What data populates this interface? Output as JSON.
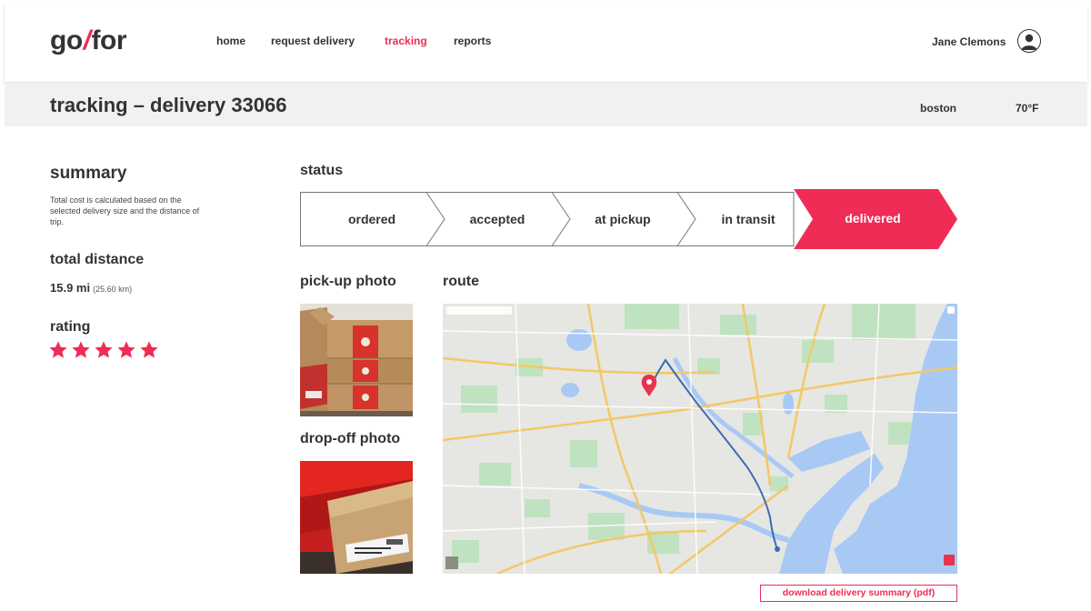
{
  "brand": {
    "logo_left": "go",
    "logo_slash": "/",
    "logo_right": "for",
    "accent_color": "#ee2c55"
  },
  "nav": {
    "items": [
      {
        "label": "home",
        "active": false
      },
      {
        "label": "request delivery",
        "active": false
      },
      {
        "label": "tracking",
        "active": true
      },
      {
        "label": "reports",
        "active": false
      }
    ]
  },
  "user": {
    "name": "Jane Clemons",
    "icon": "user-avatar-icon"
  },
  "subheader": {
    "title": "tracking – delivery 33066",
    "city": "boston",
    "temperature": "70°F"
  },
  "summary": {
    "heading": "summary",
    "description": "Total cost is calculated based on the selected delivery size and the distance of trip.",
    "distance_heading": "total distance",
    "distance_value": "15.9 mi",
    "distance_km": "(25.60 km)",
    "rating_heading": "rating",
    "rating_stars": 5,
    "rating_max": 5
  },
  "status": {
    "heading": "status",
    "steps": [
      {
        "label": "ordered",
        "done": false
      },
      {
        "label": "accepted",
        "done": false
      },
      {
        "label": "at pickup",
        "done": false
      },
      {
        "label": "in transit",
        "done": false
      },
      {
        "label": "delivered",
        "done": true
      }
    ],
    "current_step": "delivered"
  },
  "photos": {
    "pickup_heading": "pick-up photo",
    "dropoff_heading": "drop-off photo"
  },
  "route": {
    "heading": "route"
  },
  "actions": {
    "download_label": "download delivery summary (pdf)"
  }
}
